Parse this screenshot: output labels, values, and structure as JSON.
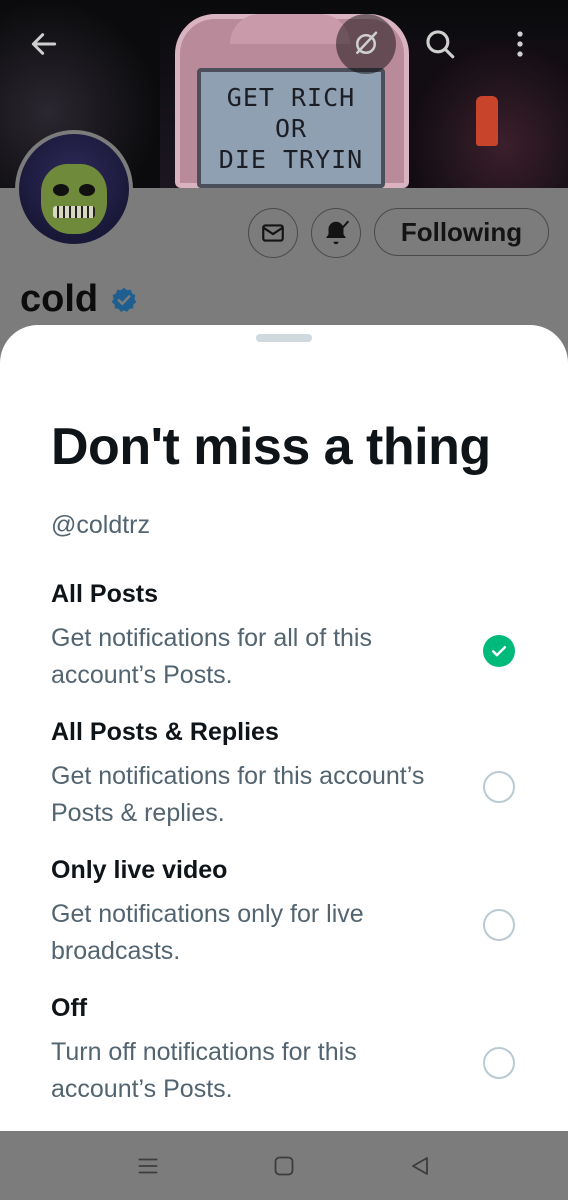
{
  "header": {
    "back_icon": "arrow-left-icon",
    "grok_icon": "grok-icon",
    "search_icon": "search-icon",
    "more_icon": "more-vertical-icon"
  },
  "banner": {
    "sign_lines": [
      "GET RICH",
      "OR",
      "DIE TRYIN"
    ]
  },
  "profile": {
    "display_name": "cold",
    "message_icon": "mail-icon",
    "bell_icon": "bell-check-icon",
    "following_label": "Following",
    "verified_color": "#1d9bf0"
  },
  "sheet": {
    "title": "Don't miss a thing",
    "handle": "@coldtrz",
    "options": [
      {
        "title": "All Posts",
        "desc": "Get notifications for all of this account’s Posts.",
        "selected": true
      },
      {
        "title": "All Posts & Replies",
        "desc": "Get notifications for this account’s Posts & replies.",
        "selected": false
      },
      {
        "title": "Only live video",
        "desc": "Get notifications only for live broadcasts.",
        "selected": false
      },
      {
        "title": "Off",
        "desc": "Turn off notifications for this account’s Posts.",
        "selected": false
      }
    ],
    "selected_color": "#00ba7c"
  },
  "navbar": {
    "menu_icon": "recent-apps-icon",
    "home_icon": "home-square-icon",
    "back_icon": "back-triangle-icon"
  }
}
